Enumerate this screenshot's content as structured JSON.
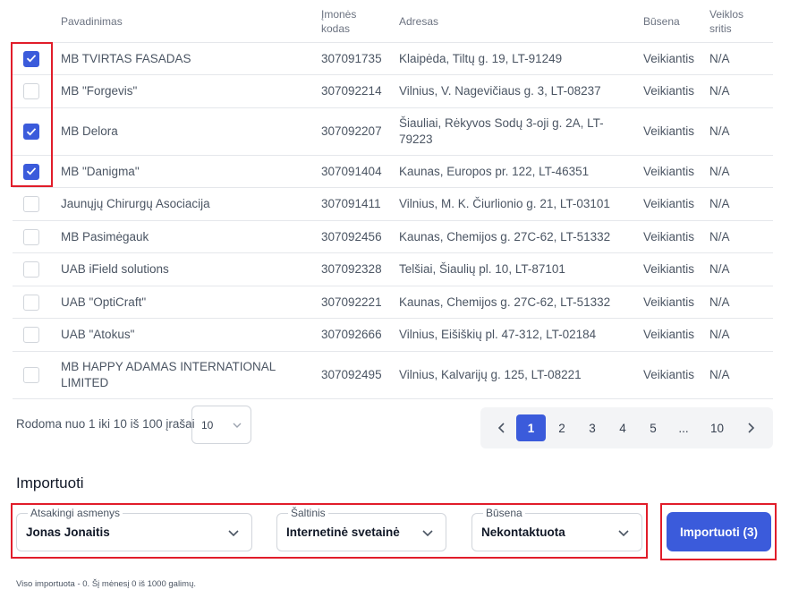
{
  "table": {
    "headers": {
      "name": "Pavadinimas",
      "code_line1": "Įmonės",
      "code_line2": "kodas",
      "address": "Adresas",
      "status": "Būsena",
      "field_line1": "Veiklos",
      "field_line2": "sritis"
    },
    "rows": [
      {
        "checked": true,
        "name": "MB TVIRTAS FASADAS",
        "code": "307091735",
        "address": "Klaipėda, Tiltų g. 19, LT-91249",
        "status": "Veikiantis",
        "field": "N/A"
      },
      {
        "checked": false,
        "name": "MB \"Forgevis\"",
        "code": "307092214",
        "address": "Vilnius, V. Nagevičiaus g. 3, LT-08237",
        "status": "Veikiantis",
        "field": "N/A"
      },
      {
        "checked": true,
        "name": "MB Delora",
        "code": "307092207",
        "address": "Šiauliai, Rėkyvos Sodų 3-oji g. 2A, LT-79223",
        "status": "Veikiantis",
        "field": "N/A"
      },
      {
        "checked": true,
        "name": "MB \"Danigma\"",
        "code": "307091404",
        "address": "Kaunas, Europos pr. 122, LT-46351",
        "status": "Veikiantis",
        "field": "N/A"
      },
      {
        "checked": false,
        "name": "Jaunųjų Chirurgų Asociacija",
        "code": "307091411",
        "address": "Vilnius, M. K. Čiurlionio g. 21, LT-03101",
        "status": "Veikiantis",
        "field": "N/A"
      },
      {
        "checked": false,
        "name": "MB Pasimėgauk",
        "code": "307092456",
        "address": "Kaunas, Chemijos g. 27C-62, LT-51332",
        "status": "Veikiantis",
        "field": "N/A"
      },
      {
        "checked": false,
        "name": "UAB iField solutions",
        "code": "307092328",
        "address": "Telšiai, Šiaulių pl. 10, LT-87101",
        "status": "Veikiantis",
        "field": "N/A"
      },
      {
        "checked": false,
        "name": "UAB \"OptiCraft\"",
        "code": "307092221",
        "address": "Kaunas, Chemijos g. 27C-62, LT-51332",
        "status": "Veikiantis",
        "field": "N/A"
      },
      {
        "checked": false,
        "name": "UAB \"Atokus\"",
        "code": "307092666",
        "address": "Vilnius, Eišiškių pl. 47-312, LT-02184",
        "status": "Veikiantis",
        "field": "N/A"
      },
      {
        "checked": false,
        "name": "MB HAPPY ADAMAS INTERNATIONAL LIMITED",
        "code": "307092495",
        "address": "Vilnius, Kalvarijų g. 125, LT-08221",
        "status": "Veikiantis",
        "field": "N/A"
      }
    ]
  },
  "footer": {
    "showing_text": "Rodoma nuo 1 iki 10 iš 100 įrašai",
    "page_size": "10"
  },
  "pagination": {
    "prev_icon": "chevron-left-icon",
    "next_icon": "chevron-right-icon",
    "pages": [
      "1",
      "2",
      "3",
      "4",
      "5",
      "...",
      "10"
    ],
    "active_page": "1"
  },
  "import": {
    "title": "Importuoti",
    "responsible_label": "Atsakingi asmenys",
    "responsible_value": "Jonas Jonaitis",
    "source_label": "Šaltinis",
    "source_value": "Internetinė svetainė",
    "status_label": "Būsena",
    "status_value": "Nekontaktuota",
    "button_label": "Importuoti (3)",
    "note": "Viso importuota - 0. Šį mėnesį 0 iš 1000 galimų."
  },
  "colors": {
    "accent": "#3b5bdb",
    "highlight": "#e11d2a",
    "border": "#e5e7eb",
    "pager_bg": "#f3f4f6"
  }
}
